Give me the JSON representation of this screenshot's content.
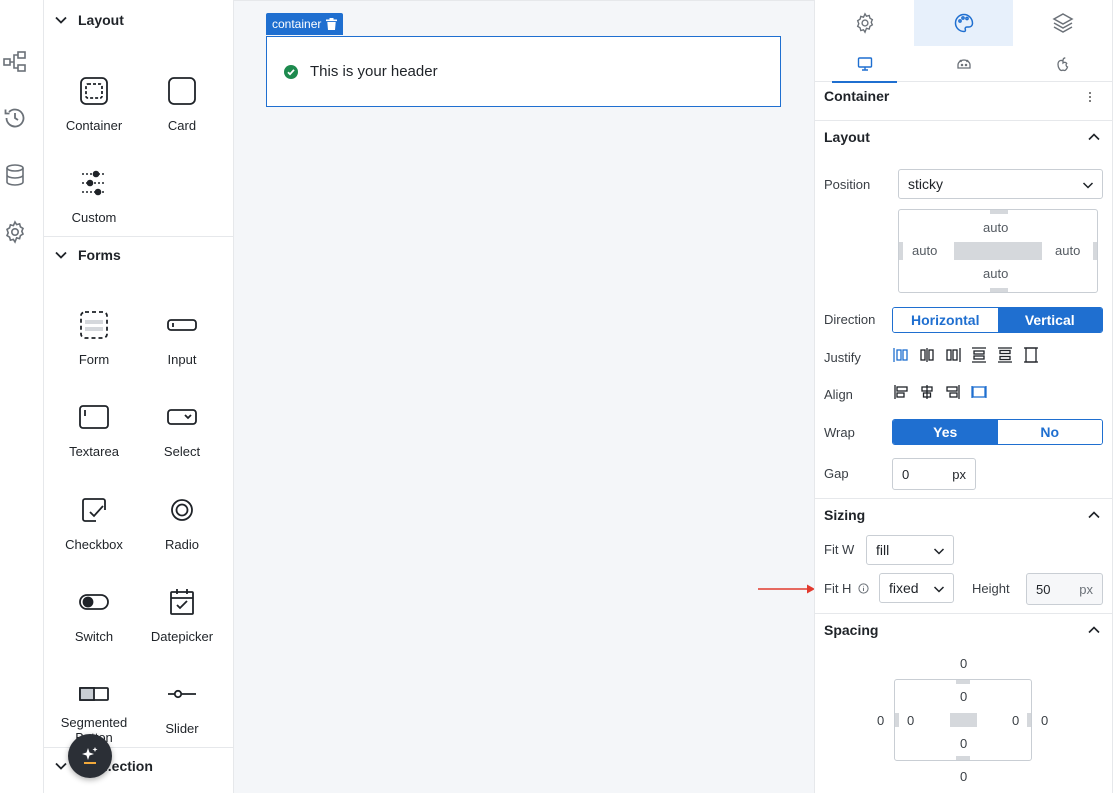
{
  "rail": {
    "icons": [
      "workflow-icon",
      "history-icon",
      "database-icon",
      "settings-icon"
    ]
  },
  "components": {
    "sections": [
      {
        "title": "Layout",
        "items": [
          "Container",
          "Card",
          "Custom"
        ]
      },
      {
        "title": "Forms",
        "items": [
          "Form",
          "Input",
          "Textarea",
          "Select",
          "Checkbox",
          "Radio",
          "Switch",
          "Datepicker",
          "Segmented Button",
          "Slider"
        ]
      },
      {
        "title": "...ection",
        "items": []
      }
    ]
  },
  "canvas": {
    "container_tag": "container",
    "header_text": "This is your header"
  },
  "props": {
    "title": "Container",
    "layout": {
      "title": "Layout",
      "position_label": "Position",
      "position_value": "sticky",
      "pos_top": "auto",
      "pos_left": "auto",
      "pos_right": "auto",
      "pos_bottom": "auto",
      "direction_label": "Direction",
      "direction_options": [
        "Horizontal",
        "Vertical"
      ],
      "direction_selected": "Vertical",
      "justify_label": "Justify",
      "align_label": "Align",
      "wrap_label": "Wrap",
      "wrap_options": [
        "Yes",
        "No"
      ],
      "wrap_selected": "Yes",
      "gap_label": "Gap",
      "gap_value": "0",
      "gap_unit": "px"
    },
    "sizing": {
      "title": "Sizing",
      "fitw_label": "Fit W",
      "fitw_value": "fill",
      "fith_label": "Fit H",
      "fith_value": "fixed",
      "height_label": "Height",
      "height_value": "50",
      "height_unit": "px"
    },
    "spacing": {
      "title": "Spacing",
      "margin_top": "0",
      "margin_left": "0",
      "margin_right": "0",
      "margin_bottom": "0",
      "padding_top": "0",
      "padding_left": "0",
      "padding_right": "0",
      "padding_bottom": "0"
    }
  },
  "colors": {
    "accent": "#1f6fd0",
    "annotation_arrow": "#e23a2e",
    "success": "#1d8a4e"
  }
}
